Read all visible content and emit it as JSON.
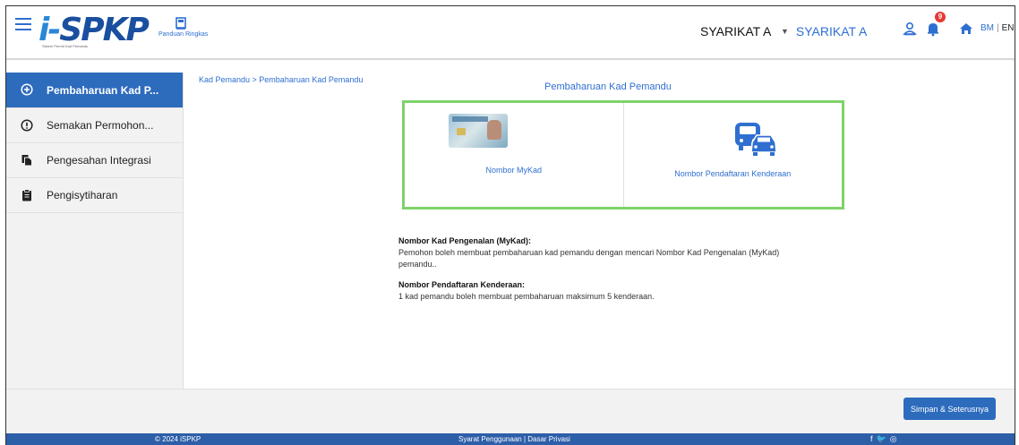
{
  "header": {
    "logo_text_i": "i-",
    "logo_text_spk": "SPKP",
    "logo_tagline": "Sistem Permit Kad Pemandu",
    "guide_label": "Panduan Ringkas",
    "company_name": "SYARIKAT A",
    "company_selected": "SYARIKAT A",
    "notification_count": "9",
    "lang_bm": "BM",
    "lang_sep": "|",
    "lang_en": "EN"
  },
  "sidebar": {
    "items": [
      {
        "label": "Pembaharuan Kad P...",
        "icon": "plus-circle-icon",
        "active": true
      },
      {
        "label": "Semakan Permohon...",
        "icon": "info-circle-icon",
        "active": false
      },
      {
        "label": "Pengesahan Integrasi",
        "icon": "documents-icon",
        "active": false
      },
      {
        "label": "Pengisytiharan",
        "icon": "clipboard-icon",
        "active": false
      }
    ]
  },
  "main": {
    "breadcrumb": "Kad Pemandu > Pembaharuan Kad Pemandu",
    "title": "Pembaharuan Kad Pemandu",
    "options": [
      {
        "label": "Nombor MyKad",
        "icon": "mykad-card-icon"
      },
      {
        "label": "Nombor Pendaftaran Kenderaan",
        "icon": "vehicles-icon"
      }
    ],
    "descriptions": [
      {
        "title": "Nombor Kad Pengenalan (MyKad):",
        "line1": "Pemohon boleh membuat pembaharuan kad pemandu dengan mencari Nombor Kad Pengenalan (MyKad)",
        "line2": "pemandu.."
      },
      {
        "title": "Nombor Pendaftaran Kenderaan:",
        "line1": "1 kad pemandu boleh membuat pembaharuan maksimum 5 kenderaan."
      }
    ]
  },
  "actions": {
    "next_label": "Simpan & Seterusnya"
  },
  "footer": {
    "copyright": "© 2024 iSPKP",
    "links": "Syarat Penggunaan | Dasar Privasi",
    "social": [
      "f",
      "🐦",
      "◎"
    ]
  },
  "colors": {
    "primary": "#2d6bbd",
    "accent_border": "#7ed36a",
    "badge": "#e53935",
    "footer": "#2d5ea8"
  }
}
